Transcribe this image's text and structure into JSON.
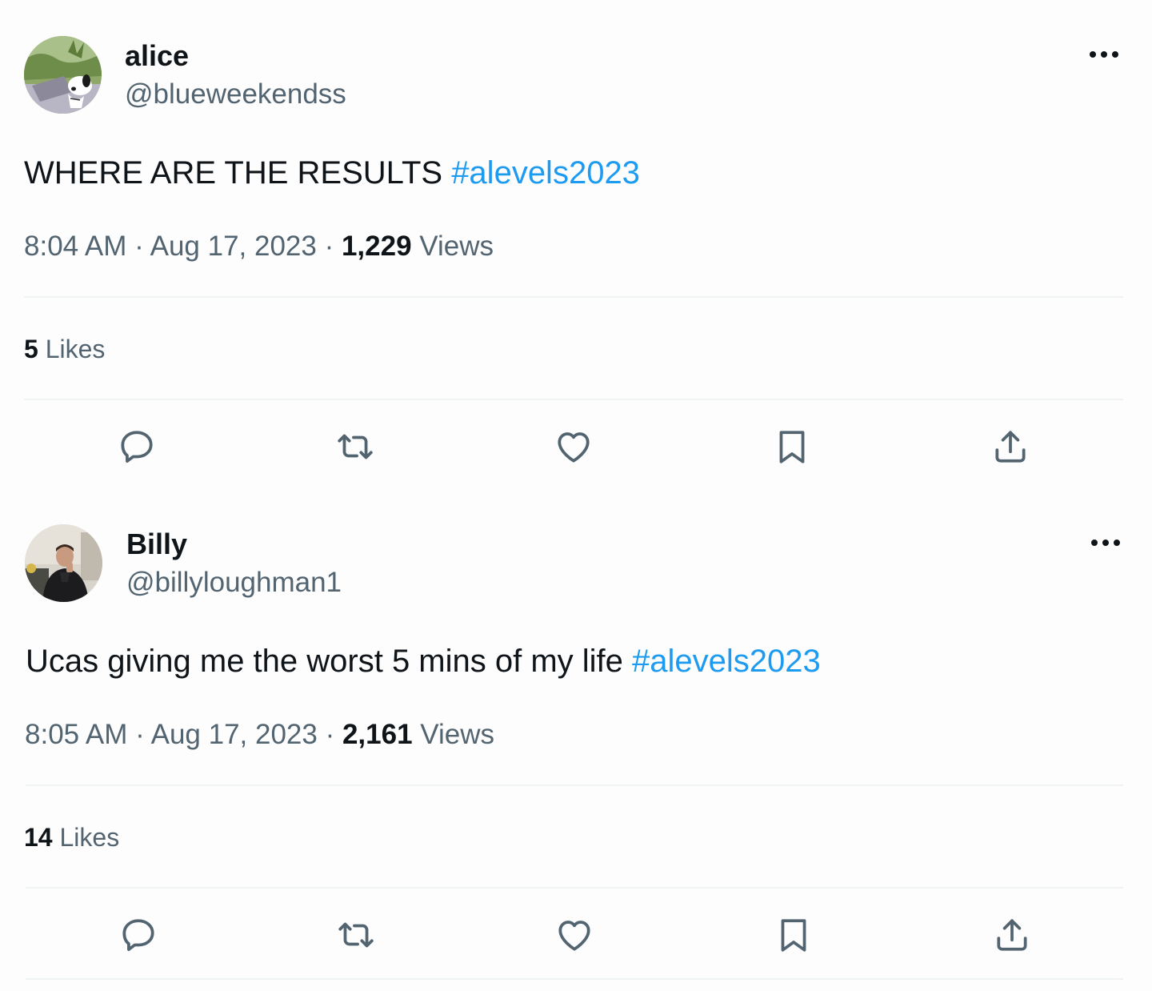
{
  "tweets": [
    {
      "display_name": "alice",
      "handle": "@blueweekendss",
      "avatar_icon": "avatar-snoopy-image",
      "text": "WHERE ARE THE RESULTS ",
      "hashtag": "#alevels2023",
      "time": "8:04 AM",
      "separator": " · ",
      "date": "Aug 17, 2023",
      "views_count": "1,229",
      "views_label": " Views",
      "likes_count": "5",
      "likes_label": " Likes"
    },
    {
      "display_name": "Billy",
      "handle": "@billyloughman1",
      "avatar_icon": "avatar-person-image",
      "text": "Ucas giving me the worst 5 mins of my life ",
      "hashtag": "#alevels2023",
      "time": "8:05 AM",
      "separator": " · ",
      "date": "Aug 17, 2023",
      "views_count": "2,161",
      "views_label": " Views",
      "likes_count": "14",
      "likes_label": " Likes"
    }
  ],
  "icons": {
    "more": "more-horizontal-icon",
    "reply": "reply-icon",
    "retweet": "retweet-icon",
    "like": "heart-icon",
    "bookmark": "bookmark-icon",
    "share": "share-icon"
  },
  "colors": {
    "text_primary": "#0f1419",
    "text_secondary": "#536471",
    "hashtag": "#1d9bf0",
    "divider": "#eff3f4",
    "background": "#fdfdfe"
  }
}
